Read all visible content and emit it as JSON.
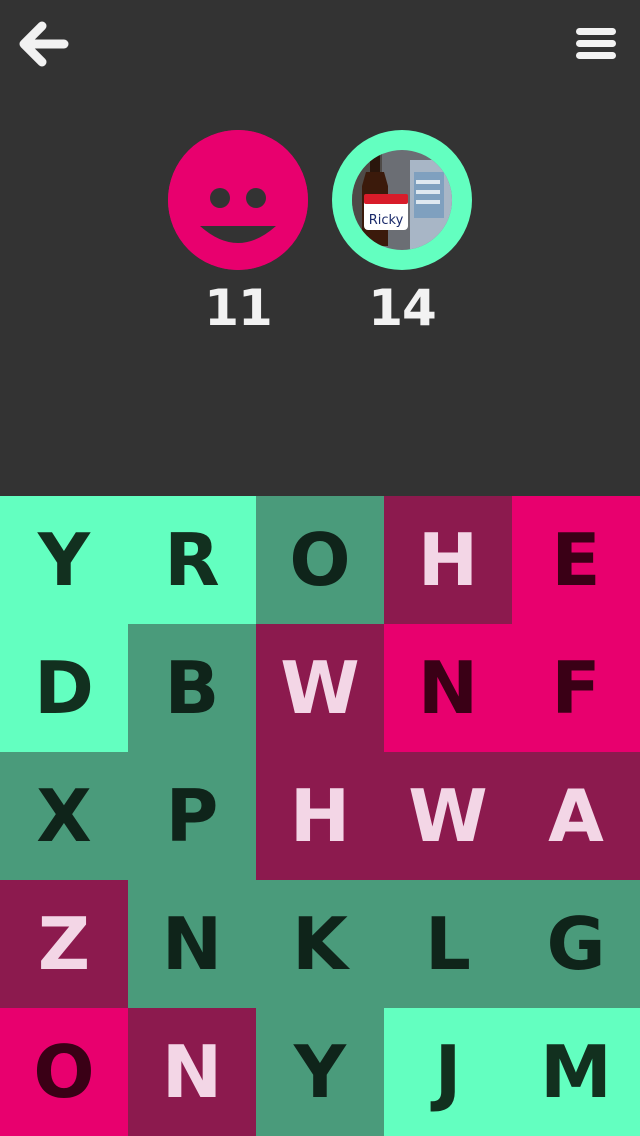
{
  "header": {
    "back_icon": "arrow-left-icon",
    "menu_icon": "hamburger-menu-icon"
  },
  "colors": {
    "background": "#333333",
    "mint": "#63FFC0",
    "teal": "#4A9B7B",
    "plum": "#8C1A4E",
    "pink": "#E8006E"
  },
  "players": [
    {
      "avatar": "smiley-face-icon",
      "score": "11",
      "color": "#E8006E"
    },
    {
      "avatar": "photo-avatar",
      "photo_label": "Ricky",
      "score": "14",
      "color": "#63FFC0"
    }
  ],
  "board": {
    "rows": [
      [
        {
          "letter": "Y",
          "color": "mint"
        },
        {
          "letter": "R",
          "color": "mint"
        },
        {
          "letter": "O",
          "color": "teal"
        },
        {
          "letter": "H",
          "color": "plum"
        },
        {
          "letter": "E",
          "color": "pink"
        }
      ],
      [
        {
          "letter": "D",
          "color": "mint"
        },
        {
          "letter": "B",
          "color": "teal"
        },
        {
          "letter": "W",
          "color": "plum"
        },
        {
          "letter": "N",
          "color": "pink"
        },
        {
          "letter": "F",
          "color": "pink"
        }
      ],
      [
        {
          "letter": "X",
          "color": "teal"
        },
        {
          "letter": "P",
          "color": "teal"
        },
        {
          "letter": "H",
          "color": "plum"
        },
        {
          "letter": "W",
          "color": "plum"
        },
        {
          "letter": "A",
          "color": "plum"
        }
      ],
      [
        {
          "letter": "Z",
          "color": "plum"
        },
        {
          "letter": "N",
          "color": "teal"
        },
        {
          "letter": "K",
          "color": "teal"
        },
        {
          "letter": "L",
          "color": "teal"
        },
        {
          "letter": "G",
          "color": "teal"
        }
      ],
      [
        {
          "letter": "O",
          "color": "pink"
        },
        {
          "letter": "N",
          "color": "plum"
        },
        {
          "letter": "Y",
          "color": "teal"
        },
        {
          "letter": "J",
          "color": "mint"
        },
        {
          "letter": "M",
          "color": "mint"
        }
      ]
    ]
  }
}
